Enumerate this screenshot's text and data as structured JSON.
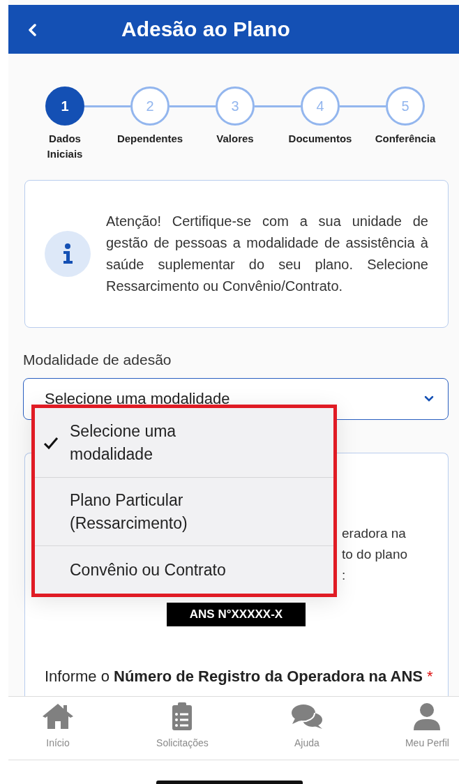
{
  "header": {
    "title": "Adesão ao Plano"
  },
  "steps": [
    {
      "number": "1",
      "label": "Dados Iniciais",
      "selected": true
    },
    {
      "number": "2",
      "label": "Dependentes",
      "selected": false
    },
    {
      "number": "3",
      "label": "Valores",
      "selected": false
    },
    {
      "number": "4",
      "label": "Documentos",
      "selected": false
    },
    {
      "number": "5",
      "label": "Conferência",
      "selected": false
    }
  ],
  "notice": {
    "text": "Atenção! Certifique-se com a sua unidade de gestão de pessoas a modalidade de assistência à saúde suplementar do seu plano. Selecione Ressarcimento ou Convênio/Contrato."
  },
  "modality": {
    "label": "Modalidade de adesão",
    "value": "Selecione uma modalidade",
    "options": [
      {
        "label": "Selecione uma modalidade",
        "selected": true
      },
      {
        "label": "Plano Particular (Ressarcimento)",
        "selected": false
      },
      {
        "label": "Convênio ou Contrato",
        "selected": false
      }
    ]
  },
  "operator_card": {
    "visible_lines": [
      "eradora na",
      "to do plano",
      ":"
    ],
    "badge": "ANS N°XXXXX-X",
    "question": "Informe o **Número de Registro da Operadora na ANS**",
    "required_marker": "*"
  },
  "bottom_nav": [
    {
      "kind": "home",
      "label": "Início"
    },
    {
      "kind": "requests",
      "label": "Solicitações"
    },
    {
      "kind": "help",
      "label": "Ajuda"
    },
    {
      "kind": "profile",
      "label": "Meu Perfil"
    }
  ]
}
